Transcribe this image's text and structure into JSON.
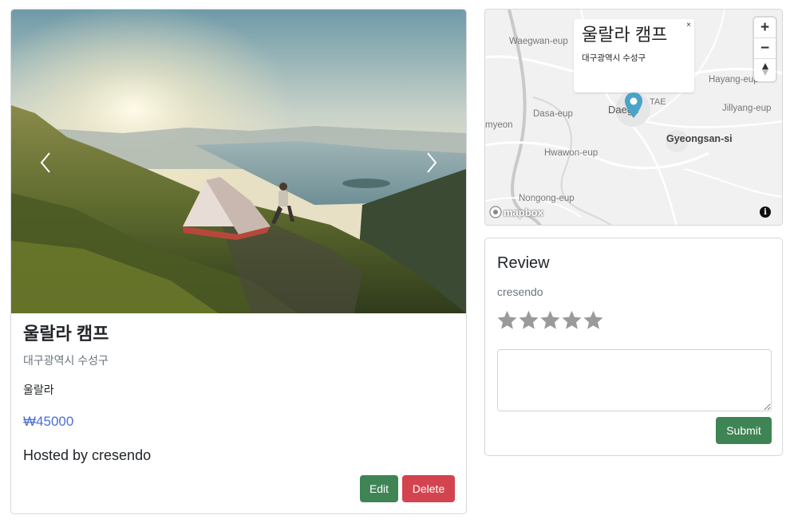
{
  "campground": {
    "title": "울랄라 캠프",
    "location": "대구광역시 수성구",
    "description": "울랄라",
    "price": "₩45000",
    "host": "Hosted by cresendo",
    "edit_label": "Edit",
    "delete_label": "Delete"
  },
  "carousel": {
    "prev_icon": "chevron-left-icon",
    "next_icon": "chevron-right-icon"
  },
  "map": {
    "popup_title": "울랄라 캠프",
    "popup_subtitle": "대구광역시 수성구",
    "popup_close": "×",
    "zoom_in": "+",
    "zoom_out": "−",
    "attribution_logo": "mapbox",
    "info_icon": "i",
    "place_labels": [
      {
        "text": "Waegwan-eup"
      },
      {
        "text": "Hayang-eup"
      },
      {
        "text": "Jillyang-eup"
      },
      {
        "text": "Dasa-eup"
      },
      {
        "text": "Daegu"
      },
      {
        "text": "TAE"
      },
      {
        "text": "Gyeongsan-si"
      },
      {
        "text": "myeon"
      },
      {
        "text": "Hwawon-eup"
      },
      {
        "text": "Nongong-eup"
      }
    ]
  },
  "review": {
    "heading": "Review",
    "username": "cresendo",
    "rating_max": 5,
    "rating_value": 0,
    "textarea_value": "",
    "submit_label": "Submit"
  },
  "colors": {
    "edit_button": "#3f8455",
    "delete_button": "#d34350",
    "submit_button": "#3f8455",
    "price": "#4a6fd6",
    "pin": "#4aa3c9"
  }
}
